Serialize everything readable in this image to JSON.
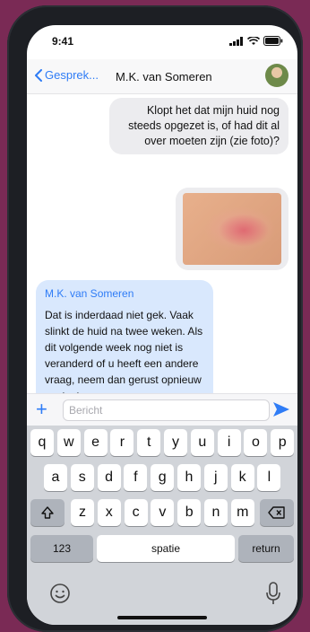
{
  "status": {
    "time": "9:41"
  },
  "nav": {
    "back_label": "Gesprek...",
    "contact_name": "M.K. van Someren"
  },
  "messages": {
    "outgoing_text": "Klopt het dat mijn huid nog steeds opgezet is, of had dit al over moeten zijn (zie foto)?",
    "incoming_sender": "M.K. van Someren",
    "incoming_text": "Dat is inderdaad niet gek. Vaak slinkt de huid na twee weken. Als dit volgende week nog niet is veranderd of u heeft een andere vraag, neem dan gerust opnieuw contact op."
  },
  "composer": {
    "placeholder": "Bericht"
  },
  "keyboard": {
    "row1": [
      "q",
      "w",
      "e",
      "r",
      "t",
      "y",
      "u",
      "i",
      "o",
      "p"
    ],
    "row2": [
      "a",
      "s",
      "d",
      "f",
      "g",
      "h",
      "j",
      "k",
      "l"
    ],
    "row3": [
      "z",
      "x",
      "c",
      "v",
      "b",
      "n",
      "m"
    ],
    "numbers_label": "123",
    "space_label": "spatie",
    "return_label": "return"
  },
  "colors": {
    "accent": "#2f7cf6",
    "incoming_bubble": "#d9e8fd",
    "outgoing_bubble": "#ececef"
  },
  "icons": [
    "signal-icon",
    "wifi-icon",
    "battery-icon",
    "chevron-left-icon",
    "plus-icon",
    "send-icon",
    "shift-icon",
    "backspace-icon",
    "emoji-icon",
    "microphone-icon"
  ]
}
